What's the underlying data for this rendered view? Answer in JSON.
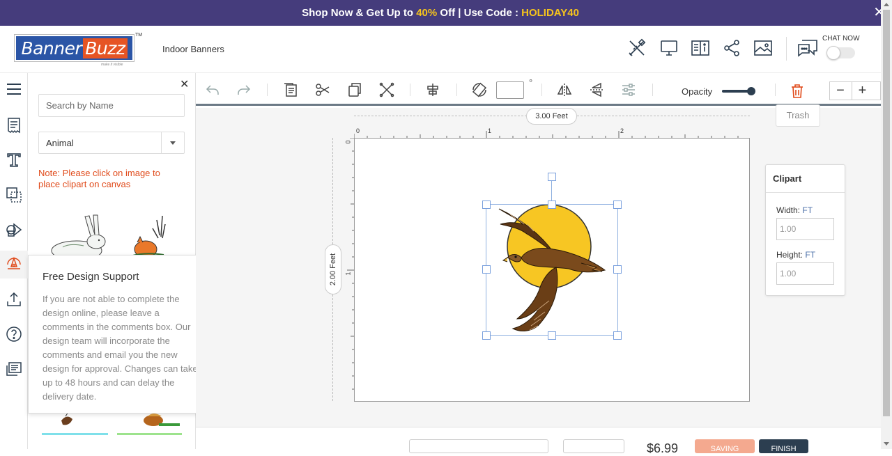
{
  "promo": {
    "text_before": "Shop Now & Get Up to ",
    "percent": "40%",
    "text_mid": " Off | Use Code : ",
    "code": "HOLIDAY40",
    "close": "✕"
  },
  "header": {
    "logo_banner": "Banner",
    "logo_buzz": "Buzz",
    "logo_tagline": "make it visible",
    "logo_tm": "TM",
    "product": "Indoor Banners",
    "icons": [
      "tools-icon",
      "desktop-preview-icon",
      "spec-icon",
      "share-icon",
      "image-icon",
      "chat-icon"
    ],
    "chat_label": "CHAT NOW"
  },
  "rail": [
    "menu-icon",
    "templates-icon",
    "text-icon",
    "layers-icon",
    "shapes-icon",
    "clipart-icon",
    "upload-icon",
    "help-icon",
    "comments-icon"
  ],
  "panel": {
    "close": "✕",
    "search_placeholder": "Search by Name",
    "category": "Animal",
    "note": "Note: Please click on image to place clipart on canvas"
  },
  "popover": {
    "title": "Free Design Support",
    "body": "If you are not able to complete the design online, please leave a comments in the comments box. Our design team will incorporate the comments and email you the new design for approval. Changes can take up to 48 hours and can delay the delivery date.",
    "close": "✕"
  },
  "toolbar": {
    "icons": [
      "undo-icon",
      "redo-icon",
      "paste-icon",
      "cut-icon",
      "copy-icon",
      "delete-icon",
      "align-icon",
      "rotate-icon",
      "flip-horizontal-icon",
      "flip-vertical-icon",
      "adjust-icon"
    ],
    "degree": "°",
    "opacity_label": "Opacity",
    "opacity_value": 1.0,
    "zoom_out": "−",
    "zoom_in": "+",
    "trash_tooltip": "Trash"
  },
  "canvas": {
    "width_label": "3.00 Feet",
    "height_label": "2.00 Feet",
    "ruler_top": [
      "0",
      "1",
      "2"
    ],
    "ruler_left": [
      "0",
      "1"
    ]
  },
  "clipart_panel": {
    "title": "Clipart",
    "width_label": "Width:",
    "height_label": "Height:",
    "unit": "FT",
    "width_value": "1.00",
    "height_value": "1.00"
  },
  "footer": {
    "price": "$6.99",
    "saving": "SAVING",
    "finish": "FINISH"
  },
  "colors": {
    "promo_bg": "#453c7c",
    "promo_highlight": "#f6c41c",
    "note": "#e04a1a",
    "brand_blue": "#2b55a6",
    "brand_orange": "#e65424",
    "dark": "#2c3e50"
  }
}
